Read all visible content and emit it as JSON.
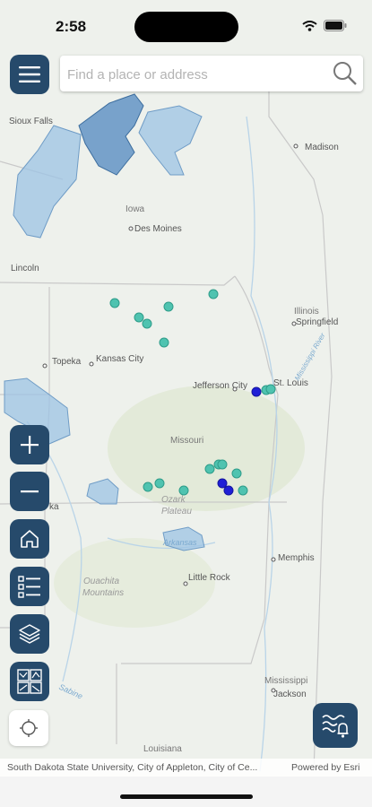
{
  "status": {
    "time": "2:58"
  },
  "search": {
    "placeholder": "Find a place or address"
  },
  "map": {
    "places": [
      {
        "name": "Sioux Falls"
      },
      {
        "name": "Madison"
      },
      {
        "name": "Iowa"
      },
      {
        "name": "Des Moines"
      },
      {
        "name": "Lincoln"
      },
      {
        "name": "Illinois"
      },
      {
        "name": "Springfield"
      },
      {
        "name": "Topeka"
      },
      {
        "name": "Kansas City"
      },
      {
        "name": "Jefferson City"
      },
      {
        "name": "St. Louis"
      },
      {
        "name": "Missouri"
      },
      {
        "name": "Ozark"
      },
      {
        "name": "Plateau"
      },
      {
        "name": "Memphis"
      },
      {
        "name": "Ouachita"
      },
      {
        "name": "Mountains"
      },
      {
        "name": "Little Rock"
      },
      {
        "name": "Mississippi"
      },
      {
        "name": "Jackson"
      },
      {
        "name": "Louisiana"
      },
      {
        "name": "Sabine"
      },
      {
        "name": "Arkansas"
      },
      {
        "name": "Mississippi River"
      },
      {
        "name": "ka"
      }
    ]
  },
  "attribution": {
    "left": "South Dakota State University, City of Appleton, City of Ce...",
    "right": "Powered by Esri"
  },
  "colors": {
    "button": "#264a6b",
    "gauge": "#4fc3b0",
    "gauge_alert": "#1f1fd6",
    "basin": "#9cc3e4"
  }
}
